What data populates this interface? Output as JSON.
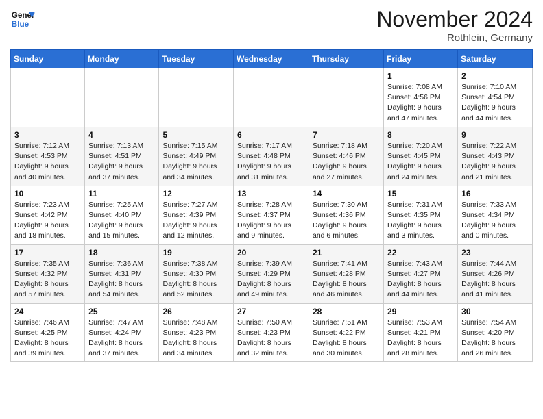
{
  "header": {
    "logo_line1": "General",
    "logo_line2": "Blue",
    "month": "November 2024",
    "location": "Rothlein, Germany"
  },
  "weekdays": [
    "Sunday",
    "Monday",
    "Tuesday",
    "Wednesday",
    "Thursday",
    "Friday",
    "Saturday"
  ],
  "weeks": [
    [
      {
        "day": "",
        "info": ""
      },
      {
        "day": "",
        "info": ""
      },
      {
        "day": "",
        "info": ""
      },
      {
        "day": "",
        "info": ""
      },
      {
        "day": "",
        "info": ""
      },
      {
        "day": "1",
        "info": "Sunrise: 7:08 AM\nSunset: 4:56 PM\nDaylight: 9 hours\nand 47 minutes."
      },
      {
        "day": "2",
        "info": "Sunrise: 7:10 AM\nSunset: 4:54 PM\nDaylight: 9 hours\nand 44 minutes."
      }
    ],
    [
      {
        "day": "3",
        "info": "Sunrise: 7:12 AM\nSunset: 4:53 PM\nDaylight: 9 hours\nand 40 minutes."
      },
      {
        "day": "4",
        "info": "Sunrise: 7:13 AM\nSunset: 4:51 PM\nDaylight: 9 hours\nand 37 minutes."
      },
      {
        "day": "5",
        "info": "Sunrise: 7:15 AM\nSunset: 4:49 PM\nDaylight: 9 hours\nand 34 minutes."
      },
      {
        "day": "6",
        "info": "Sunrise: 7:17 AM\nSunset: 4:48 PM\nDaylight: 9 hours\nand 31 minutes."
      },
      {
        "day": "7",
        "info": "Sunrise: 7:18 AM\nSunset: 4:46 PM\nDaylight: 9 hours\nand 27 minutes."
      },
      {
        "day": "8",
        "info": "Sunrise: 7:20 AM\nSunset: 4:45 PM\nDaylight: 9 hours\nand 24 minutes."
      },
      {
        "day": "9",
        "info": "Sunrise: 7:22 AM\nSunset: 4:43 PM\nDaylight: 9 hours\nand 21 minutes."
      }
    ],
    [
      {
        "day": "10",
        "info": "Sunrise: 7:23 AM\nSunset: 4:42 PM\nDaylight: 9 hours\nand 18 minutes."
      },
      {
        "day": "11",
        "info": "Sunrise: 7:25 AM\nSunset: 4:40 PM\nDaylight: 9 hours\nand 15 minutes."
      },
      {
        "day": "12",
        "info": "Sunrise: 7:27 AM\nSunset: 4:39 PM\nDaylight: 9 hours\nand 12 minutes."
      },
      {
        "day": "13",
        "info": "Sunrise: 7:28 AM\nSunset: 4:37 PM\nDaylight: 9 hours\nand 9 minutes."
      },
      {
        "day": "14",
        "info": "Sunrise: 7:30 AM\nSunset: 4:36 PM\nDaylight: 9 hours\nand 6 minutes."
      },
      {
        "day": "15",
        "info": "Sunrise: 7:31 AM\nSunset: 4:35 PM\nDaylight: 9 hours\nand 3 minutes."
      },
      {
        "day": "16",
        "info": "Sunrise: 7:33 AM\nSunset: 4:34 PM\nDaylight: 9 hours\nand 0 minutes."
      }
    ],
    [
      {
        "day": "17",
        "info": "Sunrise: 7:35 AM\nSunset: 4:32 PM\nDaylight: 8 hours\nand 57 minutes."
      },
      {
        "day": "18",
        "info": "Sunrise: 7:36 AM\nSunset: 4:31 PM\nDaylight: 8 hours\nand 54 minutes."
      },
      {
        "day": "19",
        "info": "Sunrise: 7:38 AM\nSunset: 4:30 PM\nDaylight: 8 hours\nand 52 minutes."
      },
      {
        "day": "20",
        "info": "Sunrise: 7:39 AM\nSunset: 4:29 PM\nDaylight: 8 hours\nand 49 minutes."
      },
      {
        "day": "21",
        "info": "Sunrise: 7:41 AM\nSunset: 4:28 PM\nDaylight: 8 hours\nand 46 minutes."
      },
      {
        "day": "22",
        "info": "Sunrise: 7:43 AM\nSunset: 4:27 PM\nDaylight: 8 hours\nand 44 minutes."
      },
      {
        "day": "23",
        "info": "Sunrise: 7:44 AM\nSunset: 4:26 PM\nDaylight: 8 hours\nand 41 minutes."
      }
    ],
    [
      {
        "day": "24",
        "info": "Sunrise: 7:46 AM\nSunset: 4:25 PM\nDaylight: 8 hours\nand 39 minutes."
      },
      {
        "day": "25",
        "info": "Sunrise: 7:47 AM\nSunset: 4:24 PM\nDaylight: 8 hours\nand 37 minutes."
      },
      {
        "day": "26",
        "info": "Sunrise: 7:48 AM\nSunset: 4:23 PM\nDaylight: 8 hours\nand 34 minutes."
      },
      {
        "day": "27",
        "info": "Sunrise: 7:50 AM\nSunset: 4:23 PM\nDaylight: 8 hours\nand 32 minutes."
      },
      {
        "day": "28",
        "info": "Sunrise: 7:51 AM\nSunset: 4:22 PM\nDaylight: 8 hours\nand 30 minutes."
      },
      {
        "day": "29",
        "info": "Sunrise: 7:53 AM\nSunset: 4:21 PM\nDaylight: 8 hours\nand 28 minutes."
      },
      {
        "day": "30",
        "info": "Sunrise: 7:54 AM\nSunset: 4:20 PM\nDaylight: 8 hours\nand 26 minutes."
      }
    ]
  ]
}
